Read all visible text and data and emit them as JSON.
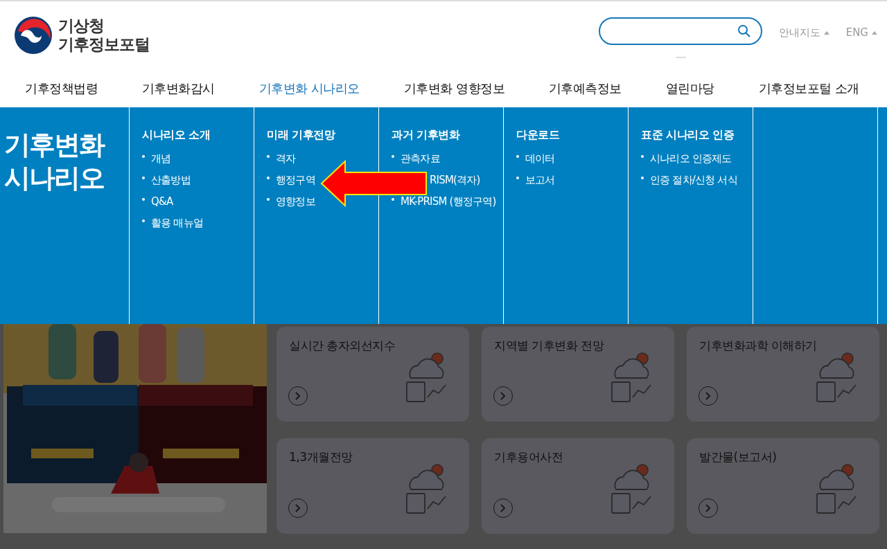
{
  "header": {
    "logo": {
      "line1": "기상청",
      "line2": "기후정보포털"
    },
    "links": [
      {
        "label": "안내지도"
      },
      {
        "label": "ENG"
      }
    ]
  },
  "nav": [
    {
      "label": "기후정책법령",
      "selected": false
    },
    {
      "label": "기후변화감시",
      "selected": false
    },
    {
      "label": "기후변화 시나리오",
      "selected": true
    },
    {
      "label": "기후변화 영향정보",
      "selected": false
    },
    {
      "label": "기후예측정보",
      "selected": false
    },
    {
      "label": "열린마당",
      "selected": false
    },
    {
      "label": "기후정보포털 소개",
      "selected": false
    }
  ],
  "mega_menu": {
    "title": "기후변화 시나리오",
    "columns": [
      {
        "heading": "시나리오 소개",
        "items": [
          {
            "label": "개념",
            "covered": false
          },
          {
            "label": "산출방법",
            "covered": false
          },
          {
            "label": "Q&A",
            "covered": false
          },
          {
            "label": "활용 매뉴얼",
            "covered": false
          }
        ]
      },
      {
        "heading": "미래 기후전망",
        "items": [
          {
            "label": "격자",
            "covered": false
          },
          {
            "label": "행정구역",
            "covered": false
          },
          {
            "label": "영향정보",
            "covered": false
          }
        ]
      },
      {
        "heading": "과거 기후변화",
        "items": [
          {
            "label": "관측자료",
            "covered": false
          },
          {
            "label": "RISM(격자)",
            "covered": true
          },
          {
            "label": "MK-PRISM (행정구역)",
            "covered": false
          }
        ]
      },
      {
        "heading": "다운로드",
        "items": [
          {
            "label": "데이터",
            "covered": false
          },
          {
            "label": "보고서",
            "covered": false
          }
        ]
      },
      {
        "heading": "표준 시나리오 인증",
        "items": [
          {
            "label": "시나리오 인증제도",
            "covered": false
          },
          {
            "label": "인증 절차/신청 서식",
            "covered": false
          }
        ]
      }
    ]
  },
  "cards": [
    {
      "title": "실시간 총자외선지수"
    },
    {
      "title": "지역별 기후변화 전망"
    },
    {
      "title": "기후변화과학 이해하기"
    },
    {
      "title": "1,3개월전망"
    },
    {
      "title": "기후용어사전"
    },
    {
      "title": "발간물(보고서)"
    }
  ]
}
